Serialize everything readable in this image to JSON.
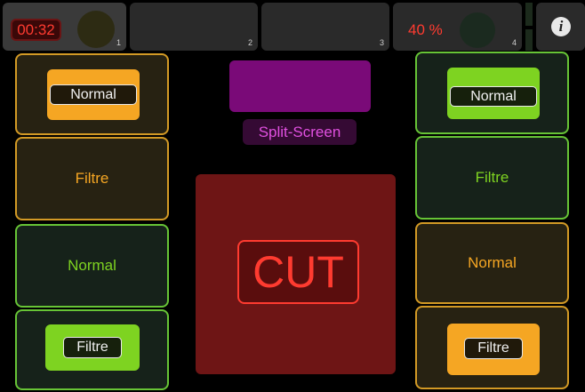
{
  "top_bar": {
    "slots": [
      {
        "number": "1",
        "timer": "00:32"
      },
      {
        "number": "2"
      },
      {
        "number": "3"
      },
      {
        "number": "4",
        "percent": "40 %"
      }
    ],
    "info_icon": "info-icon"
  },
  "left_column": {
    "pads": [
      {
        "label": "Normal",
        "style": "orange",
        "selected": true
      },
      {
        "label": "Filtre",
        "style": "orange",
        "selected": false
      },
      {
        "label": "Normal",
        "style": "green",
        "selected": false
      },
      {
        "label": "Filtre",
        "style": "green",
        "selected": true
      }
    ]
  },
  "right_column": {
    "pads": [
      {
        "label": "Normal",
        "style": "green",
        "selected": true
      },
      {
        "label": "Filtre",
        "style": "green",
        "selected": false
      },
      {
        "label": "Normal",
        "style": "orange",
        "selected": false
      },
      {
        "label": "Filtre",
        "style": "orange",
        "selected": true
      }
    ]
  },
  "center": {
    "split_label": "Split-Screen",
    "cut_label": "CUT"
  },
  "colors": {
    "orange": "#f5a623",
    "green": "#7ed321",
    "magenta": "#7a0a78",
    "cut_red": "#ff3b30"
  }
}
